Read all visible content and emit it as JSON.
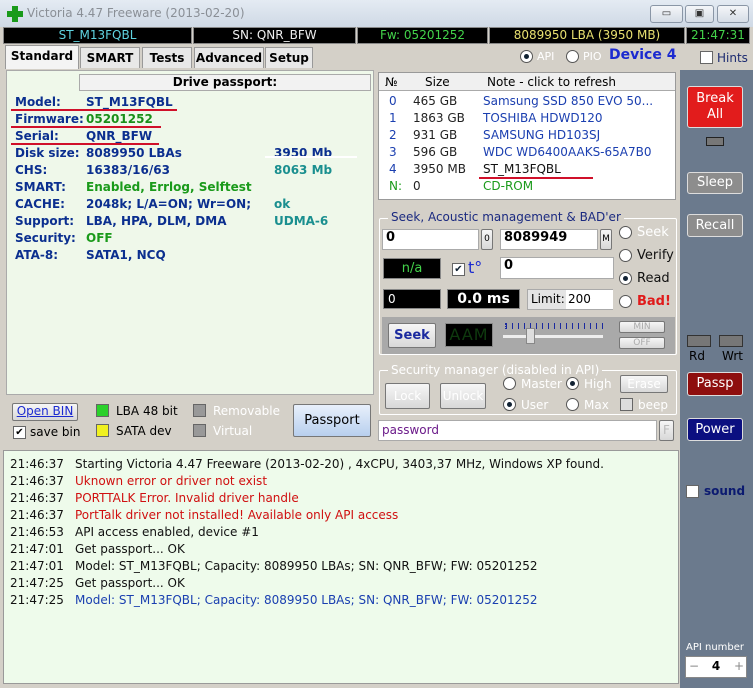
{
  "window": {
    "title": "Victoria 4.47  Freeware (2013-02-20)",
    "minimize": "▭",
    "maximize": "▣",
    "close": "✕"
  },
  "infobar": {
    "model": "ST_M13FQBL",
    "sn": "SN: QNR_BFW",
    "fw": "Fw: 05201252",
    "lba": "8089950 LBA (3950 MB)",
    "time": "21:47:31"
  },
  "tabs": [
    "Standard",
    "SMART",
    "Tests",
    "Advanced",
    "Setup"
  ],
  "mode": {
    "api": "API",
    "pio": "PIO",
    "device": "Device 4",
    "hints": "Hints",
    "selected": "API"
  },
  "passport": {
    "header": "Drive passport:",
    "rows": [
      {
        "label": "Model:",
        "value": "ST_M13FQBL",
        "extra": ""
      },
      {
        "label": "Firmware:",
        "value": "05201252",
        "extra": ""
      },
      {
        "label": "Serial:",
        "value": "QNR_BFW",
        "extra": ""
      },
      {
        "label": "Disk size:",
        "value": "8089950 LBAs",
        "extra": "3950 Mb"
      },
      {
        "label": "CHS:",
        "value": "16383/16/63",
        "extra": "8063 Mb"
      },
      {
        "label": "SMART:",
        "value": "Enabled, Errlog, Selftest",
        "extra": ""
      },
      {
        "label": "CACHE:",
        "value": "2048k; L/A=ON; Wr=ON;",
        "extra": "ok"
      },
      {
        "label": "Support:",
        "value": "LBA, HPA, DLM, DMA",
        "extra": "UDMA-6"
      },
      {
        "label": "Security:",
        "value": "OFF",
        "extra": ""
      },
      {
        "label": "ATA-8:",
        "value": "SATA1, NCQ",
        "extra": ""
      }
    ]
  },
  "bottomleft": {
    "open_bin": "Open BIN",
    "save_bin": "save bin",
    "lba48": "LBA 48 bit",
    "sata": "SATA dev",
    "removable": "Removable",
    "virtual": "Virtual",
    "passport": "Passport"
  },
  "drives": {
    "headers": [
      "№",
      "Size",
      "Note - click to refresh"
    ],
    "rows": [
      {
        "n": "0",
        "size": "465 GB",
        "note": "Samsung SSD 850 EVO 50..."
      },
      {
        "n": "1",
        "size": "1863 GB",
        "note": "TOSHIBA HDWD120"
      },
      {
        "n": "2",
        "size": "931 GB",
        "note": "SAMSUNG HD103SJ"
      },
      {
        "n": "3",
        "size": "596 GB",
        "note": "WDC WD6400AAKS-65A7B0"
      },
      {
        "n": "4",
        "size": "3950 MB",
        "note": "ST_M13FQBL"
      },
      {
        "n": "N:",
        "size": "0",
        "note": "CD-ROM"
      }
    ]
  },
  "seek": {
    "title": "Seek, Acoustic management & BAD'er",
    "start": "0",
    "start_btn": "0",
    "end": "8089949",
    "end_btn": "M",
    "temp": "n/a",
    "temp_label": "t°",
    "field": "0",
    "pos": "0",
    "ms": "0.0 ms",
    "limit_label": "Limit:",
    "limit": "200",
    "modes": [
      "Seek",
      "Verify",
      "Read",
      "Bad!"
    ],
    "selected": "Read",
    "seek_btn": "Seek",
    "aam": "AAM",
    "min": "MIN",
    "off": "OFF",
    "slider": 0.3
  },
  "security": {
    "title": "Security manager (disabled in API)",
    "lock": "Lock",
    "unlock": "Unlock",
    "master": "Master",
    "high": "High",
    "user": "User",
    "max": "Max",
    "erase": "Erase",
    "beep": "beep",
    "password": "password",
    "f": "F"
  },
  "sidebar": {
    "break": "Break All",
    "sleep": "Sleep",
    "recall": "Recall",
    "rd": "Rd",
    "wrt": "Wrt",
    "passp": "Passp",
    "power": "Power",
    "sound": "sound",
    "api_number_label": "API number",
    "api_number": "4",
    "minus": "−",
    "plus": "+"
  },
  "log": [
    {
      "time": "21:46:37",
      "msg": "Starting Victoria 4.47  Freeware (2013-02-20) , 4xCPU, 3403,37 MHz, Windows XP found.",
      "color": "#111111"
    },
    {
      "time": "21:46:37",
      "msg": "Uknown error or driver not exist",
      "color": "#d01010"
    },
    {
      "time": "21:46:37",
      "msg": "PORTTALK Error. Invalid driver handle",
      "color": "#d01010"
    },
    {
      "time": "21:46:37",
      "msg": "PortTalk driver not installed! Available only API access",
      "color": "#d01010"
    },
    {
      "time": "21:46:53",
      "msg": "API access enabled, device #1",
      "color": "#111111"
    },
    {
      "time": "21:47:01",
      "msg": "Get passport... OK",
      "color": "#111111"
    },
    {
      "time": "21:47:01",
      "msg": "Model: ST_M13FQBL; Capacity: 8089950 LBAs; SN: QNR_BFW; FW: 05201252",
      "color": "#111111"
    },
    {
      "time": "21:47:25",
      "msg": "Get passport... OK",
      "color": "#111111"
    },
    {
      "time": "21:47:25",
      "msg": "Model: ST_M13FQBL; Capacity: 8089950 LBAs; SN: QNR_BFW; FW: 05201252",
      "color": "#1a3fb0"
    }
  ]
}
